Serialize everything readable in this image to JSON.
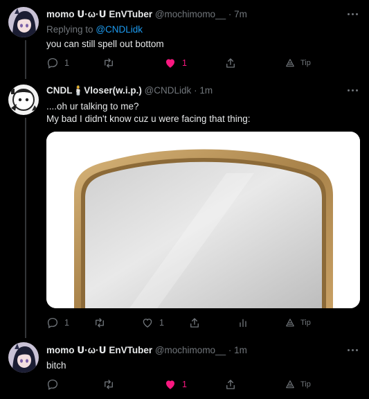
{
  "colors": {
    "background": "#000000",
    "text": "#e7e9ea",
    "muted": "#71767b",
    "mention": "#1d9bf0",
    "like_active": "#f91880"
  },
  "tweets": [
    {
      "display_name": "momo ᑌ·ω·ᑌ EnVTuber",
      "handle": "@mochimomo__",
      "time": "7m",
      "replying_prefix": "Replying to",
      "replying_to": "@CNDLidk",
      "text": "you can still spell out bottom",
      "actions": {
        "reply_count": "1",
        "retweet_count": "",
        "like_count": "1",
        "liked": true,
        "tip_label": "Tip"
      }
    },
    {
      "display_name": "CNDL🕯️Vloser(w.i.p.)",
      "handle": "@CNDLidk",
      "time": "1m",
      "text_lines": [
        "....oh ur talking to me?",
        "My bad I didn't know cuz u were facing that thing:"
      ],
      "media": "mirror-photo",
      "actions": {
        "reply_count": "1",
        "retweet_count": "",
        "like_count": "1",
        "liked": false,
        "tip_label": "Tip"
      }
    },
    {
      "display_name": "momo ᑌ·ω·ᑌ EnVTuber",
      "handle": "@mochimomo__",
      "time": "1m",
      "text": "bitch",
      "actions": {
        "reply_count": "",
        "retweet_count": "",
        "like_count": "1",
        "liked": true,
        "tip_label": "Tip"
      }
    }
  ],
  "sep": "·"
}
